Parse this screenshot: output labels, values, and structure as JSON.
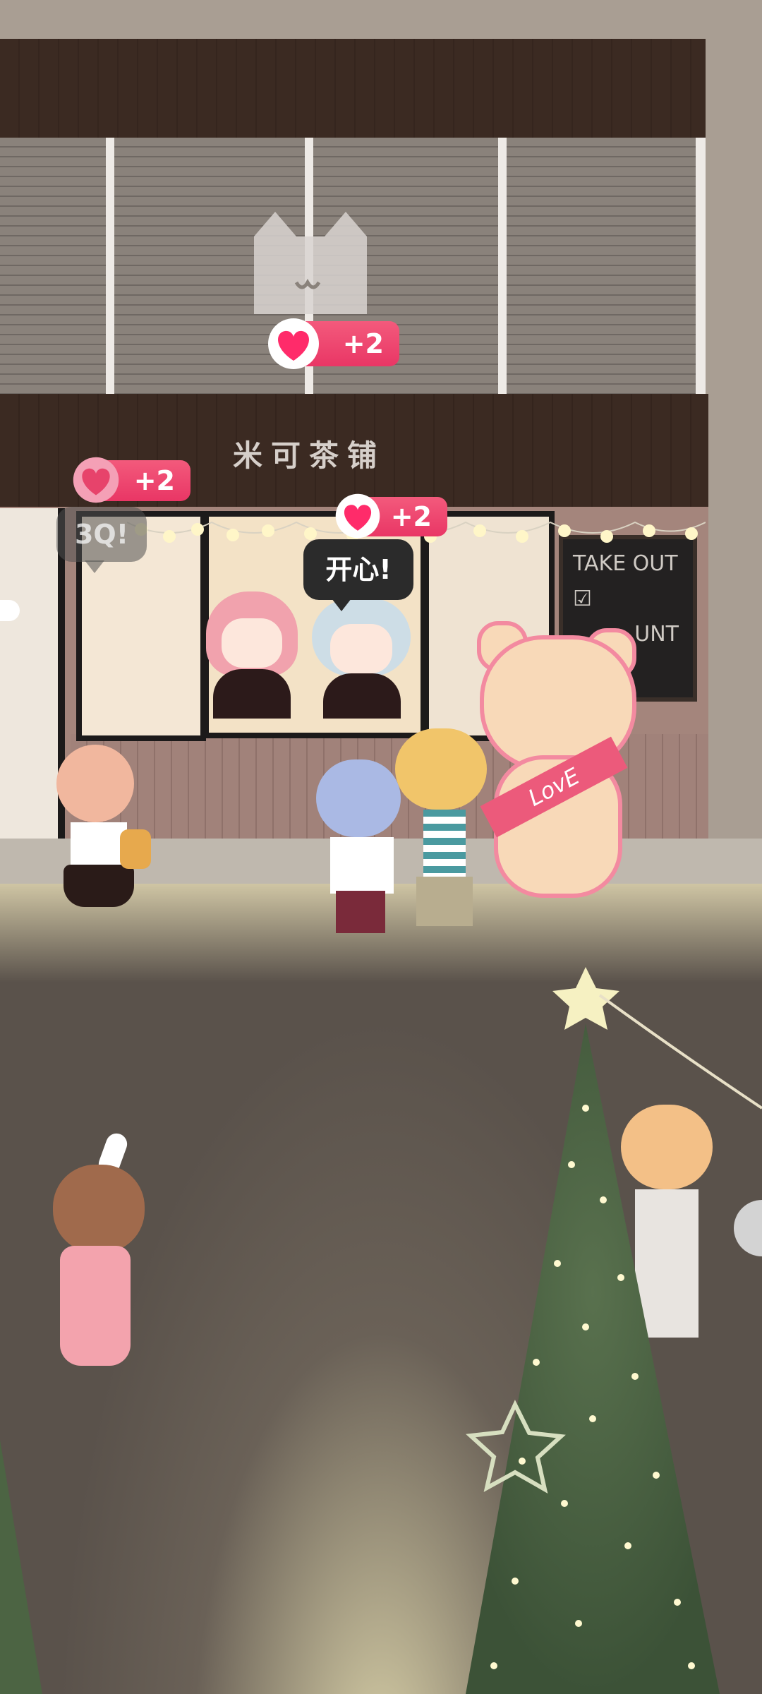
{
  "shop": {
    "sign_text": "米可茶铺",
    "chalkboard_lines": [
      "TAKE OUT",
      "☑",
      "UNT"
    ],
    "bear_sash_text": "LovE"
  },
  "popups": [
    {
      "label": "+2"
    },
    {
      "label": "+2"
    },
    {
      "label": "+2"
    }
  ],
  "speech": {
    "left": "3Q!",
    "window": "开心!"
  },
  "colors": {
    "heart": "#ff2b6a",
    "pill": "#e93665",
    "storefront_roof": "#3b2a22",
    "street": "#5a524b"
  }
}
